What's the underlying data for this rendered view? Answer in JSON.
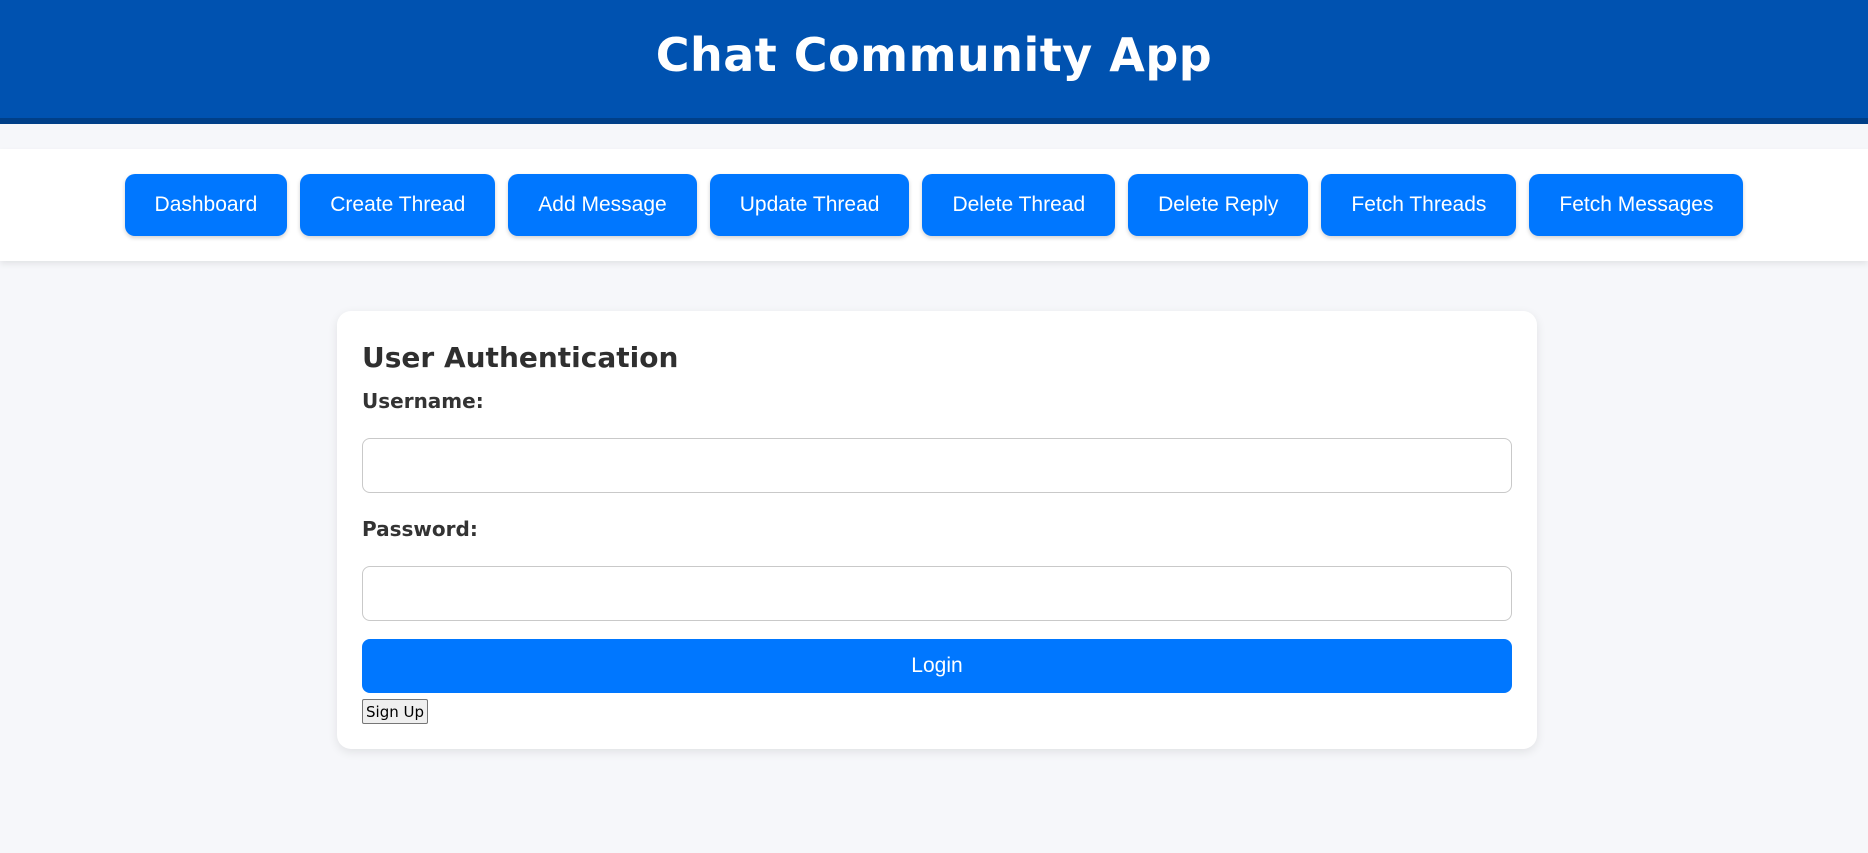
{
  "header": {
    "title": "Chat Community App"
  },
  "nav": {
    "buttons": [
      {
        "label": "Dashboard"
      },
      {
        "label": "Create Thread"
      },
      {
        "label": "Add Message"
      },
      {
        "label": "Update Thread"
      },
      {
        "label": "Delete Thread"
      },
      {
        "label": "Delete Reply"
      },
      {
        "label": "Fetch Threads"
      },
      {
        "label": "Fetch Messages"
      }
    ]
  },
  "auth": {
    "title": "User Authentication",
    "username_label": "Username:",
    "username_value": "",
    "password_label": "Password:",
    "password_value": "",
    "login_label": "Login",
    "signup_label": "Sign Up"
  },
  "colors": {
    "header_bg": "#0052b0",
    "accent": "#0077ff",
    "page_bg": "#f6f7fa"
  }
}
